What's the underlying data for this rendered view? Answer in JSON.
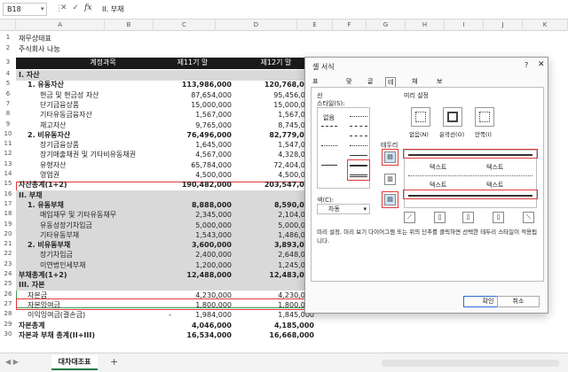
{
  "formula_bar": {
    "name_box": "B18",
    "fx": "fx",
    "content": "II. 부채"
  },
  "columns": [
    "A",
    "B",
    "C",
    "D",
    "E",
    "F",
    "G",
    "H",
    "I",
    "J",
    "K"
  ],
  "sheet": {
    "title": "재무상태표",
    "company": "주식회사 나눔",
    "header": {
      "name": "계정과목",
      "v1": "제11기 말",
      "v2": "제12기 말"
    },
    "rows": [
      {
        "n": "4",
        "name": "I. 자산",
        "v1": "",
        "v2": "",
        "style": "bold shade"
      },
      {
        "n": "5",
        "name": "1. 유동자산",
        "v1": "113,986,000",
        "v2": "120,768,000",
        "style": "bold"
      },
      {
        "n": "6",
        "name": "현금 및 현금성 자산",
        "v1": "87,654,000",
        "v2": "95,456,000",
        "style": "ind2"
      },
      {
        "n": "7",
        "name": "단기금융상품",
        "v1": "15,000,000",
        "v2": "15,000,000",
        "style": "ind2"
      },
      {
        "n": "8",
        "name": "기타유동금융자산",
        "v1": "1,567,000",
        "v2": "1,567,000",
        "style": "ind2"
      },
      {
        "n": "9",
        "name": "재고자산",
        "v1": "9,765,000",
        "v2": "8,745,000",
        "style": "ind2"
      },
      {
        "n": "10",
        "name": "2. 비유동자산",
        "v1": "76,496,000",
        "v2": "82,779,000",
        "style": "bold"
      },
      {
        "n": "11",
        "name": "장기금융상품",
        "v1": "1,645,000",
        "v2": "1,547,000",
        "style": "ind2"
      },
      {
        "n": "12",
        "name": "장기매출채권 및 기타비유동채권",
        "v1": "4,567,000",
        "v2": "4,328,000",
        "style": "ind2"
      },
      {
        "n": "13",
        "name": "유형자산",
        "v1": "65,784,000",
        "v2": "72,404,000",
        "style": "ind2"
      },
      {
        "n": "14",
        "name": "영업권",
        "v1": "4,500,000",
        "v2": "4,500,000",
        "style": "ind2"
      },
      {
        "n": "15",
        "name": "자산총계(1+2)",
        "v1": "190,482,000",
        "v2": "203,547,000",
        "style": "bold"
      },
      {
        "n": "16",
        "name": "II. 부채",
        "v1": "",
        "v2": "",
        "style": "bold shade"
      },
      {
        "n": "17",
        "name": "1. 유동부채",
        "v1": "8,888,000",
        "v2": "8,590,000",
        "style": "bold shade"
      },
      {
        "n": "18",
        "name": "매입채무 및 기타유동채무",
        "v1": "2,345,000",
        "v2": "2,104,000",
        "style": "ind2 shade"
      },
      {
        "n": "19",
        "name": "유동성장기차입금",
        "v1": "5,000,000",
        "v2": "5,000,000",
        "style": "ind2 shade"
      },
      {
        "n": "20",
        "name": "기타유동부채",
        "v1": "1,543,000",
        "v2": "1,486,000",
        "style": "ind2 shade"
      },
      {
        "n": "21",
        "name": "2. 비유동부채",
        "v1": "3,600,000",
        "v2": "3,893,000",
        "style": "bold shade"
      },
      {
        "n": "22",
        "name": "장기차입금",
        "v1": "2,400,000",
        "v2": "2,648,000",
        "style": "ind2 shade"
      },
      {
        "n": "23",
        "name": "이연법인세부채",
        "v1": "1,200,000",
        "v2": "1,245,000",
        "style": "ind2 shade"
      },
      {
        "n": "24",
        "name": "부채총계(1+2)",
        "v1": "12,488,000",
        "v2": "12,483,000",
        "style": "bold shade"
      },
      {
        "n": "25",
        "name": "III. 자본",
        "v1": "",
        "v2": "",
        "style": "bold shade"
      },
      {
        "n": "26",
        "name": "자본금",
        "v1": "4,230,000",
        "v2": "4,230,000",
        "style": "ind1"
      },
      {
        "n": "27",
        "name": "자본잉여금",
        "v1": "1,800,000",
        "v2": "1,800,000",
        "style": "ind1"
      },
      {
        "n": "28",
        "name": "이익잉여금(결손금)",
        "v1": "1,984,000",
        "v2": "1,845,000",
        "style": "ind1",
        "dash": "-"
      },
      {
        "n": "29",
        "name": "자본총계",
        "v1": "4,046,000",
        "v2": "4,185,000",
        "style": "bold"
      },
      {
        "n": "30",
        "name": "자본과 부채 총계(II+III)",
        "v1": "16,534,000",
        "v2": "16,668,000",
        "style": "bold"
      }
    ]
  },
  "sheet_tab": {
    "name": "대차대조표",
    "add": "+"
  },
  "dialog": {
    "title": "셀 서식",
    "help": "?",
    "close": "✕",
    "tabs": [
      "표시 형식",
      "맞춤",
      "글꼴",
      "테두리",
      "채우기",
      "보호"
    ],
    "active_tab": "테두리",
    "line_label": "선",
    "style_label": "스타일(S):",
    "none_label": "없음",
    "color_label": "색(C):",
    "color_value": "자동",
    "presets_label": "미리 설정",
    "presets": [
      "없음(N)",
      "윤곽선(O)",
      "안쪽(I)"
    ],
    "border_label": "테두리",
    "preview_text": [
      "텍스트",
      "텍스트",
      "텍스트",
      "텍스트"
    ],
    "hint": "미리 설정, 미리 보기 다이어그램 또는 위의 단추를 클릭하면 선택한 테두리 스타일이 적용됩니다.",
    "ok": "확인",
    "cancel": "취소"
  }
}
